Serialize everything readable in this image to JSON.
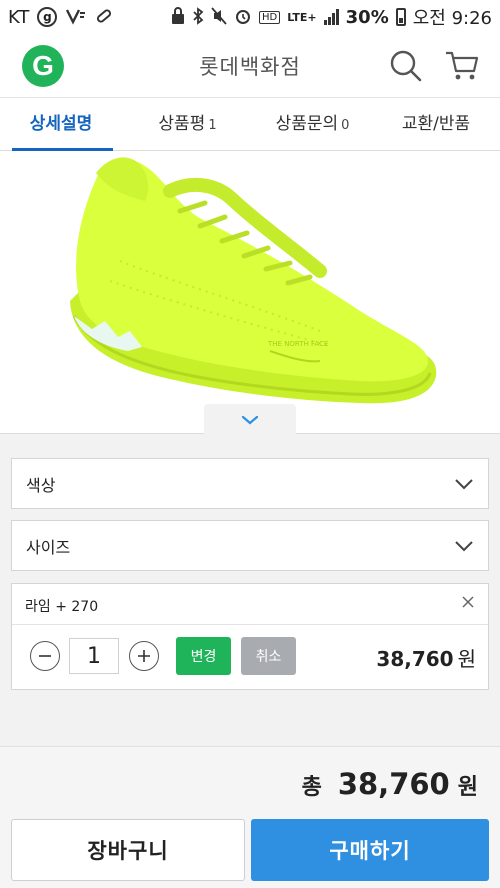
{
  "status_bar": {
    "carrier": "KT",
    "hd_label": "HD",
    "network": "LTE+",
    "battery": "30%",
    "time": "오전 9:26"
  },
  "header": {
    "logo_text": "G",
    "title": "롯데백화점",
    "icons": [
      "search-icon",
      "cart-icon"
    ]
  },
  "tabs": [
    {
      "label": "상세설명",
      "count": "",
      "active": true
    },
    {
      "label": "상품평",
      "count": "1",
      "active": false
    },
    {
      "label": "상품문의",
      "count": "0",
      "active": false
    },
    {
      "label": "교환/반품",
      "count": "",
      "active": false
    }
  ],
  "product_image": {
    "brand_mark": "THE NORTH FACE",
    "color": "#d8ff3a"
  },
  "options": {
    "color_label": "색상",
    "size_label": "사이즈"
  },
  "selected_item": {
    "name": "라임 + 270",
    "quantity": "1",
    "change_label": "변경",
    "cancel_label": "취소",
    "price": "38,760",
    "currency": "원"
  },
  "summary": {
    "total_label": "총",
    "total_amount": "38,760",
    "currency": "원"
  },
  "actions": {
    "cart_label": "장바구니",
    "buy_label": "구매하기"
  },
  "colors": {
    "brand_green": "#21b35a",
    "tab_active": "#1565c0",
    "buy_blue": "#2f8fe0",
    "cancel_gray": "#a8acb1"
  }
}
